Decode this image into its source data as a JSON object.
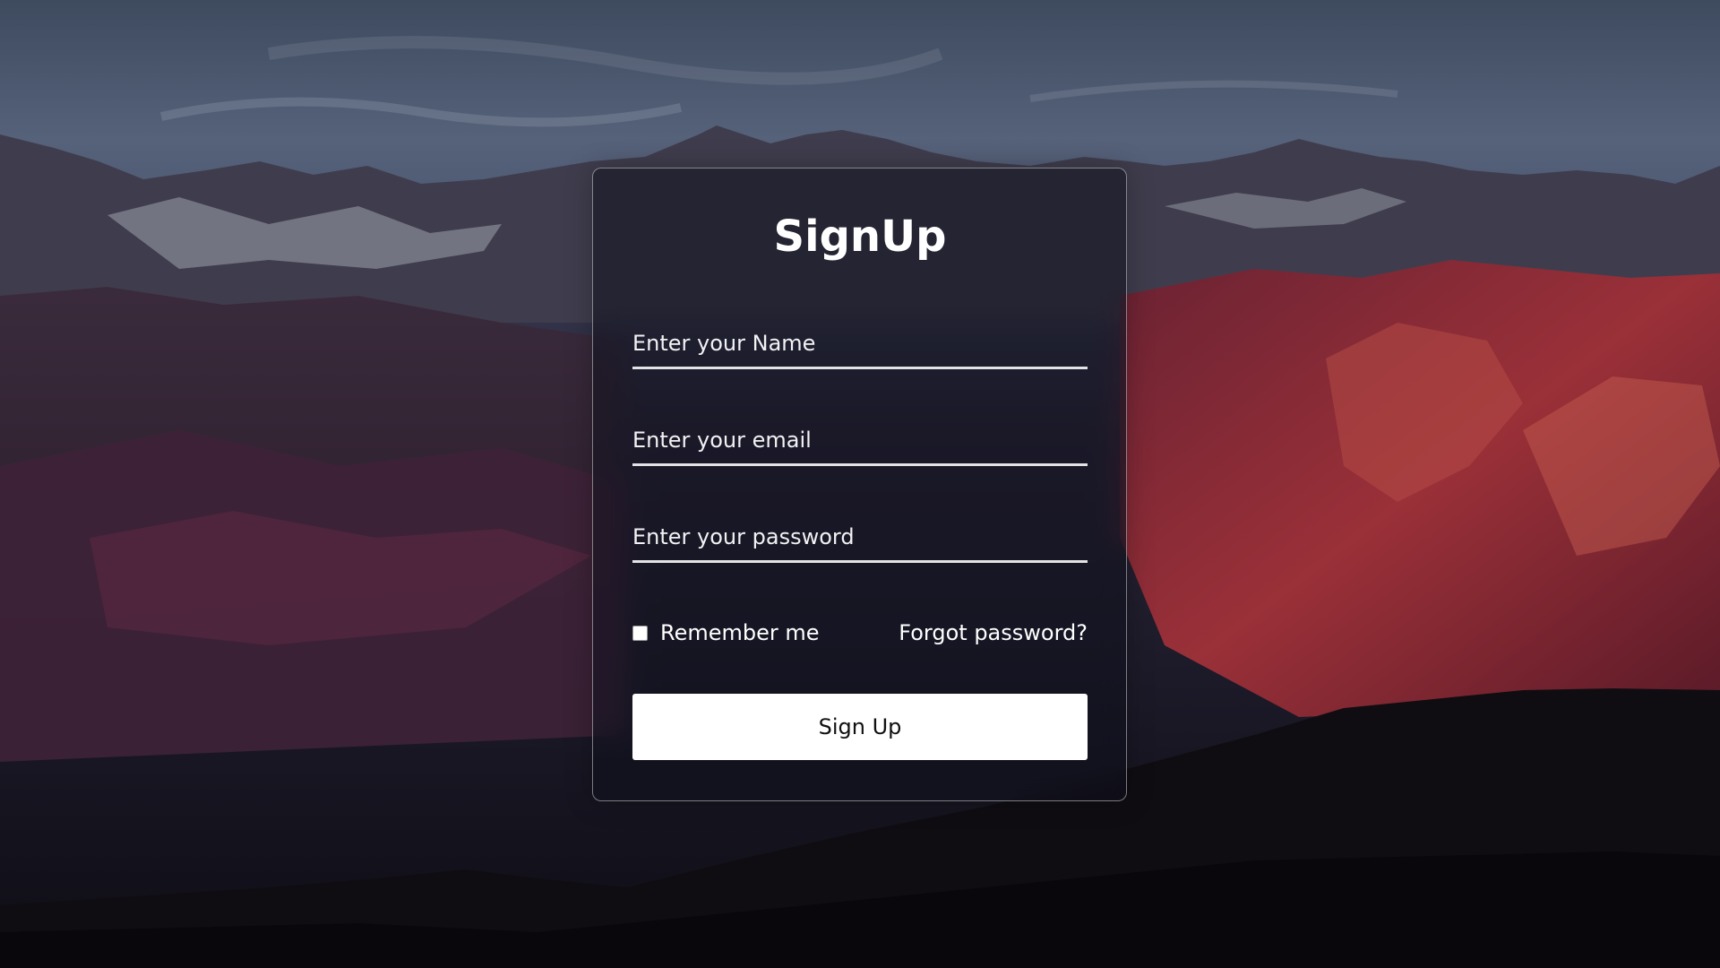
{
  "form": {
    "title": "SignUp",
    "name_placeholder": "Enter your Name",
    "email_placeholder": "Enter your email",
    "password_placeholder": "Enter your password",
    "remember_label": "Remember me",
    "remember_checked": false,
    "forgot_label": "Forgot password?",
    "submit_label": "Sign Up"
  },
  "colors": {
    "text": "#ffffff",
    "underline": "#e3e3e6",
    "button_bg": "#ffffff",
    "button_text": "#111111",
    "card_border": "#bfc0c6"
  }
}
